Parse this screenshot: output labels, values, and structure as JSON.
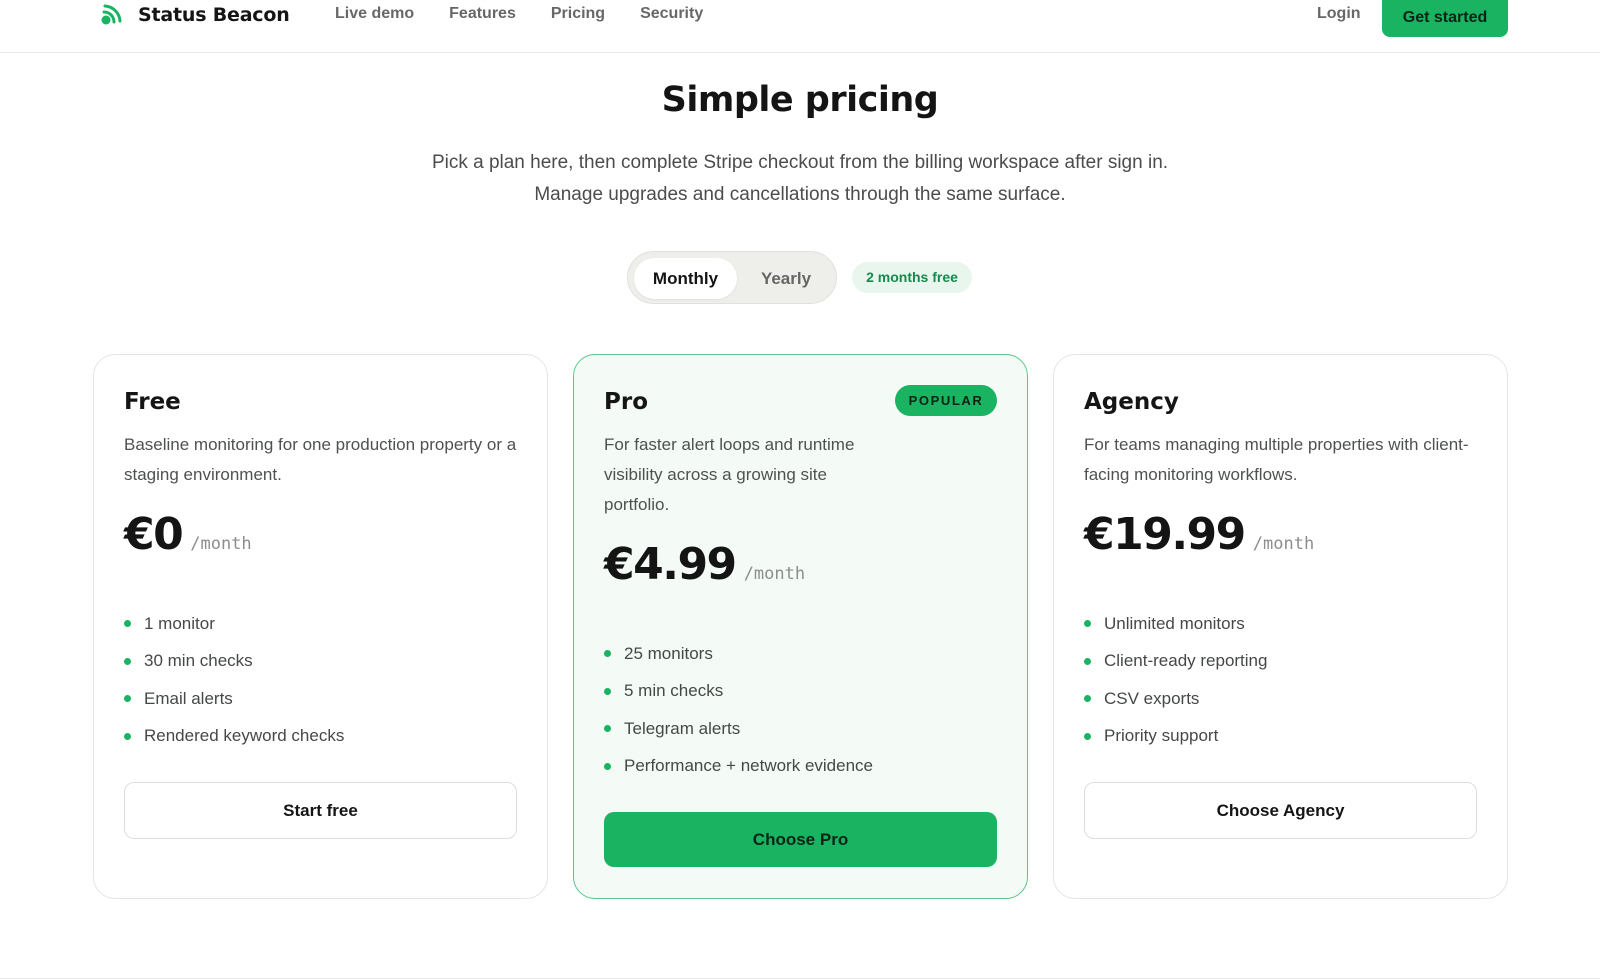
{
  "header": {
    "brand": "Status Beacon",
    "brand_icon": "signal-beacon-icon",
    "nav": [
      "Live demo",
      "Features",
      "Pricing",
      "Security"
    ],
    "login": "Login",
    "cta": "Get started"
  },
  "hero": {
    "title": "Simple pricing",
    "subtitle_line1": "Pick a plan here, then complete Stripe checkout from the billing workspace after sign in.",
    "subtitle_line2": "Manage upgrades and cancellations through the same surface."
  },
  "billing_toggle": {
    "options": [
      "Monthly",
      "Yearly"
    ],
    "selected": "Monthly",
    "promo": "2 months free"
  },
  "plans": [
    {
      "name": "Free",
      "description": "Baseline monitoring for one production property or a staging environment.",
      "price": "€0",
      "period": "/month",
      "features": [
        "1 monitor",
        "30 min checks",
        "Email alerts",
        "Rendered keyword checks"
      ],
      "button": "Start free"
    },
    {
      "name": "Pro",
      "badge": "POPULAR",
      "description": "For faster alert loops and runtime visibility across a growing site portfolio.",
      "price": "€4.99",
      "period": "/month",
      "features": [
        "25 monitors",
        "5 min checks",
        "Telegram alerts",
        "Performance + network evidence"
      ],
      "button": "Choose Pro"
    },
    {
      "name": "Agency",
      "description": "For teams managing multiple properties with client-facing monitoring workflows.",
      "price": "€19.99",
      "period": "/month",
      "features": [
        "Unlimited monitors",
        "Client-ready reporting",
        "CSV exports",
        "Priority support"
      ],
      "button": "Choose Agency"
    }
  ],
  "colors": {
    "accent": "#19b362",
    "pro_card_bg": "#f4faf6",
    "pro_card_border": "#5bc58b",
    "promo_bg": "#e9f6ee",
    "promo_text": "#168a4c"
  }
}
